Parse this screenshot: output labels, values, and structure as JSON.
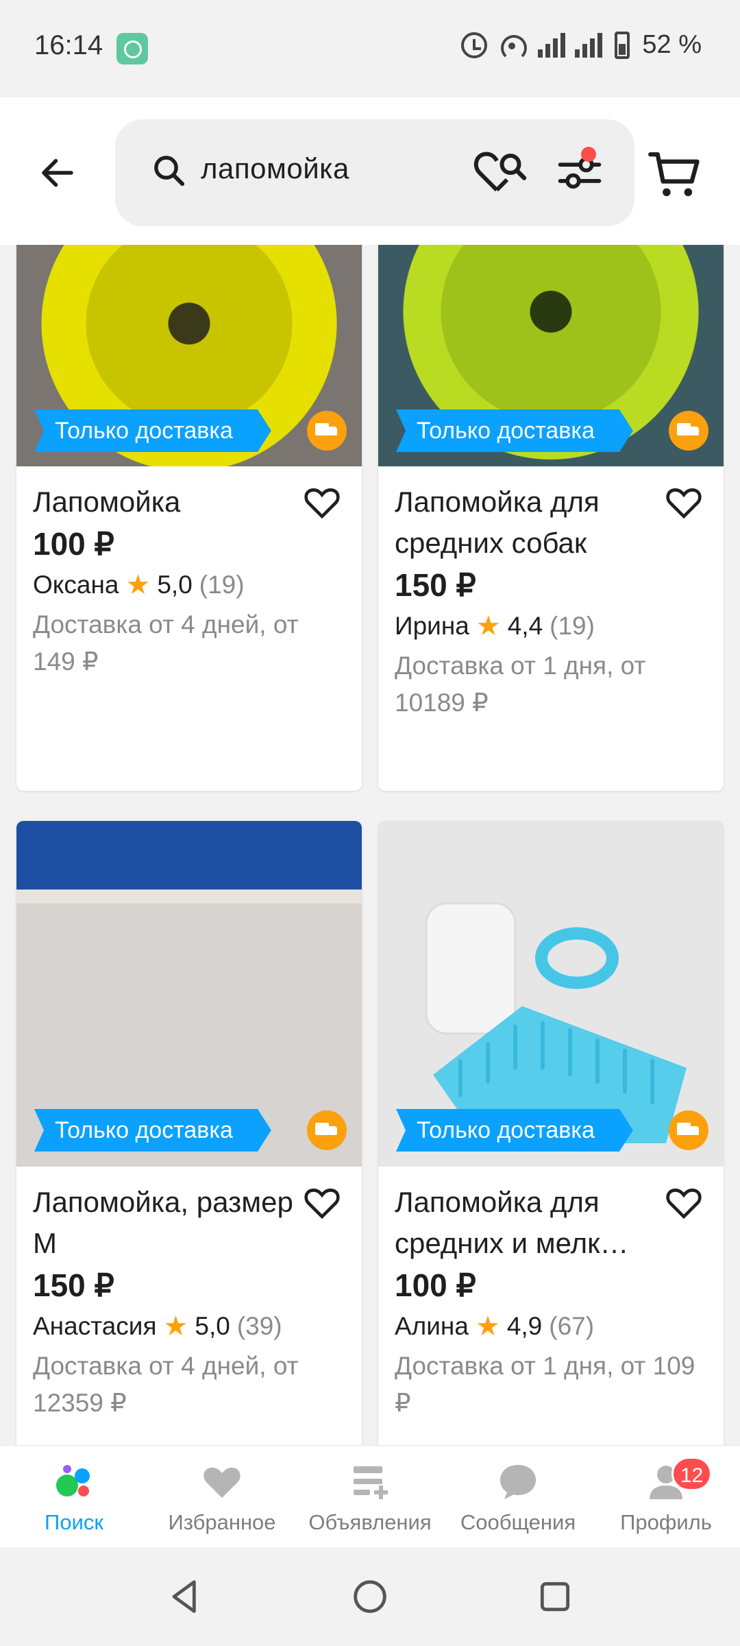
{
  "status_bar": {
    "time": "16:14",
    "battery": "52 %",
    "network": "4G"
  },
  "header": {
    "search_query": "лапомойка",
    "filter_has_dot": true
  },
  "listings": [
    {
      "title": "Лапомойка",
      "price": "100 ₽",
      "seller": "Оксана",
      "rating": "5,0",
      "reviews": "(19)",
      "delivery": "Доставка от 4 дней, от 149 ₽",
      "tag": "Только доставка"
    },
    {
      "title": "Лапомойка для средних собак",
      "price": "150 ₽",
      "seller": "Ирина",
      "rating": "4,4",
      "reviews": "(19)",
      "delivery": "Доставка от 1 дня, от 10189 ₽",
      "tag": "Только доставка"
    },
    {
      "title": "Лапомойка, размер M",
      "price": "150 ₽",
      "seller": "Анастасия",
      "rating": "5,0",
      "reviews": "(39)",
      "delivery": "Доставка от 4 дней, от 12359 ₽",
      "tag": "Только доставка"
    },
    {
      "title": "Лапомойка для средних и мелк…",
      "price": "100 ₽",
      "seller": "Алина",
      "rating": "4,9",
      "reviews": "(67)",
      "delivery": "Доставка от 1 дня, от 109 ₽",
      "tag": "Только доставка"
    }
  ],
  "bottom_nav": {
    "items": [
      {
        "label": "Поиск",
        "icon": "search-logo-icon",
        "active": true
      },
      {
        "label": "Избранное",
        "icon": "heart-icon"
      },
      {
        "label": "Объявления",
        "icon": "add-listing-icon"
      },
      {
        "label": "Сообщения",
        "icon": "chat-bubble-icon"
      },
      {
        "label": "Профиль",
        "icon": "profile-icon",
        "badge": "12"
      }
    ]
  },
  "colors": {
    "accent": "#0aa1ff",
    "star": "#fca10e",
    "badge": "#ff4d4d"
  }
}
